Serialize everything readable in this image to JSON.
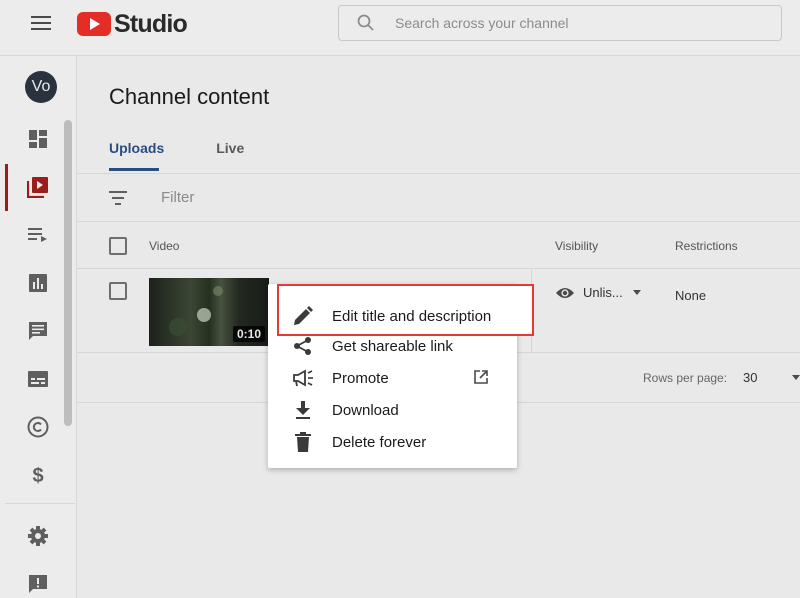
{
  "app": {
    "logo_text": "Studio"
  },
  "search": {
    "placeholder": "Search across your channel"
  },
  "sidebar": {
    "avatar_initials": "Vo",
    "items": [
      "dashboard",
      "content",
      "playlists",
      "analytics",
      "comments",
      "subtitles",
      "copyright",
      "earn",
      "settings",
      "feedback"
    ]
  },
  "main": {
    "title": "Channel content",
    "tabs": [
      {
        "label": "Uploads"
      },
      {
        "label": "Live"
      }
    ],
    "filter_placeholder": "Filter",
    "columns": {
      "video": "Video",
      "visibility": "Visibility",
      "restrictions": "Restrictions"
    },
    "row": {
      "duration": "0:10",
      "visibility": "Unlis...",
      "restrictions": "None"
    },
    "pager": {
      "rows_label": "Rows per page:",
      "rows_value": "30"
    }
  },
  "menu": {
    "items": [
      {
        "label": "Edit title and description",
        "icon": "pencil-icon"
      },
      {
        "label": "Get shareable link",
        "icon": "share-icon"
      },
      {
        "label": "Promote",
        "icon": "megaphone-icon"
      },
      {
        "label": "Download",
        "icon": "download-icon"
      },
      {
        "label": "Delete forever",
        "icon": "trash-icon"
      }
    ]
  },
  "colors": {
    "accent": "#2a4d80",
    "brand_red": "#e52d27",
    "highlight_border": "#e53935"
  }
}
